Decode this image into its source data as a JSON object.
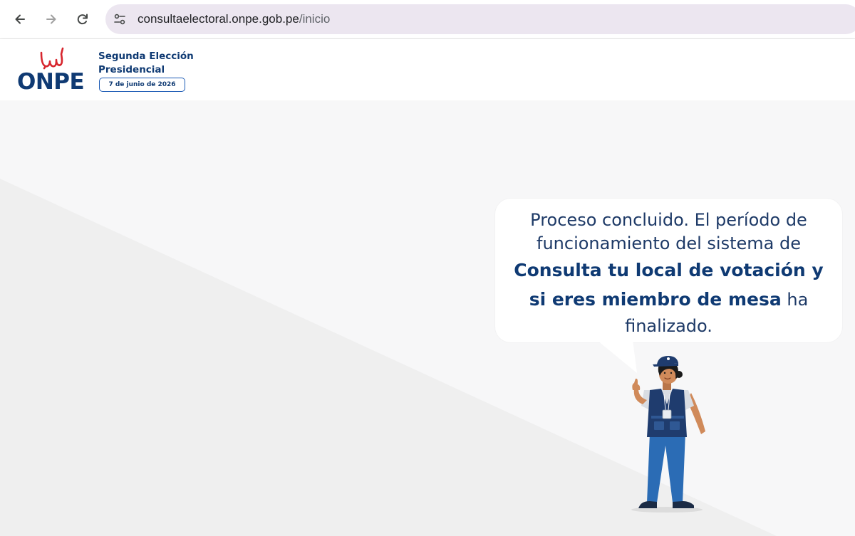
{
  "browser": {
    "url_domain": "consultaelectoral.onpe.gob.pe",
    "url_path": "/inicio",
    "icons": [
      "back-arrow-icon",
      "forward-arrow-icon",
      "reload-icon",
      "site-settings-icon"
    ]
  },
  "header": {
    "logo_text": "ONPE",
    "event_title_line1": "Segunda Elección",
    "event_title_line2": "Presidencial",
    "event_date": "7 de junio de 2026"
  },
  "message": {
    "line1": "Proceso concluido. El período de",
    "line2": "funcionamiento del sistema de",
    "line3_bold": "Consulta tu local de votación y",
    "line4_bold": "si eres miembro de mesa",
    "line4_rest": " ha",
    "line5": "finalizado."
  },
  "colors": {
    "brand_navy": "#0f3a73",
    "brand_red": "#d7262e",
    "accent_blue": "#1c5bb5",
    "omnibox": "#ece6f0"
  }
}
